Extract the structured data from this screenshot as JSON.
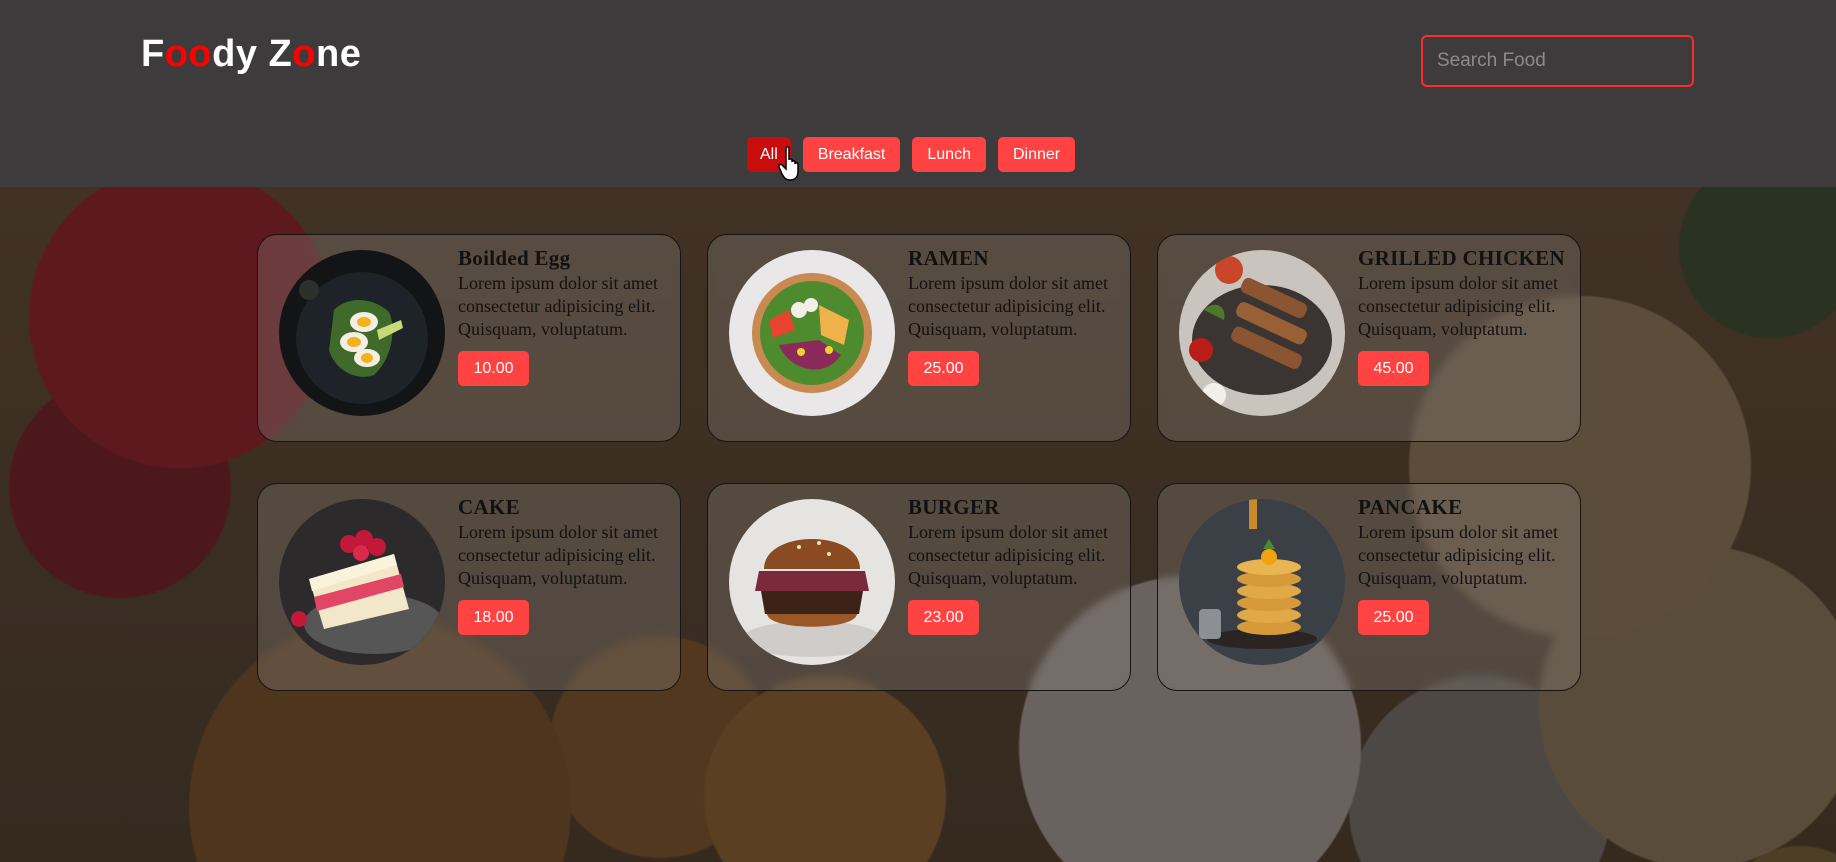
{
  "app": {
    "logo_parts": [
      {
        "text": "F",
        "red": false
      },
      {
        "text": "oo",
        "red": true
      },
      {
        "text": "dy Z",
        "red": false
      },
      {
        "text": "o",
        "red": true
      },
      {
        "text": "ne",
        "red": false
      }
    ]
  },
  "search": {
    "placeholder": "Search Food",
    "value": ""
  },
  "filters": [
    {
      "label": "All",
      "active": true
    },
    {
      "label": "Breakfast",
      "active": false
    },
    {
      "label": "Lunch",
      "active": false
    },
    {
      "label": "Dinner",
      "active": false
    }
  ],
  "colors": {
    "accent": "#ff4343",
    "accent_active": "#c90d0d",
    "logo_highlight": "#ff0000",
    "header_bg": "#3e3b3c"
  },
  "foods": [
    {
      "name": "Boilded Egg",
      "description": "Lorem ipsum dolor sit amet consectetur adipisicing elit. Quisquam, voluptatum.",
      "price": "10.00",
      "image_icon": "boiled-egg-image"
    },
    {
      "name": "RAMEN",
      "description": "Lorem ipsum dolor sit amet consectetur adipisicing elit. Quisquam, voluptatum.",
      "price": "25.00",
      "image_icon": "ramen-bowl-image"
    },
    {
      "name": "GRILLED CHICKEN",
      "description": "Lorem ipsum dolor sit amet consectetur adipisicing elit. Quisquam, voluptatum.",
      "price": "45.00",
      "image_icon": "grilled-chicken-image"
    },
    {
      "name": "CAKE",
      "description": "Lorem ipsum dolor sit amet consectetur adipisicing elit. Quisquam, voluptatum.",
      "price": "18.00",
      "image_icon": "cake-image"
    },
    {
      "name": "BURGER",
      "description": "Lorem ipsum dolor sit amet consectetur adipisicing elit. Quisquam, voluptatum.",
      "price": "23.00",
      "image_icon": "burger-image"
    },
    {
      "name": "PANCAKE",
      "description": "Lorem ipsum dolor sit amet consectetur adipisicing elit. Quisquam, voluptatum.",
      "price": "25.00",
      "image_icon": "pancake-image"
    }
  ]
}
